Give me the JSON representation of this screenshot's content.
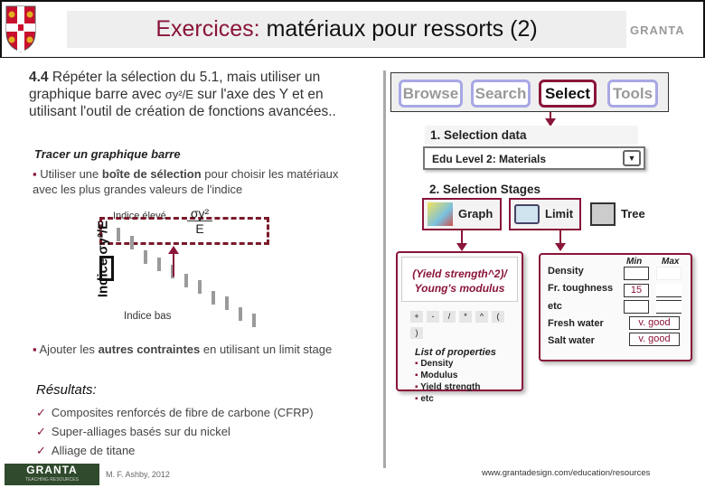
{
  "header": {
    "title_accent": "Exercices:",
    "title_rest": " matériaux pour ressorts (2)",
    "brand": "GRANTA"
  },
  "left": {
    "intro_num": "4.4",
    "intro_text": " Répéter la sélection du 5.1, mais utiliser un graphique barre avec ",
    "intro_formula": "σy²/E",
    "intro_text2": " sur l'axe des Y et en utilisant l'outil de création de fonctions avancées..",
    "subhead": "Tracer un graphique barre",
    "bullet1_pre": "Utiliser une ",
    "bullet1_bold": "boîte de sélection",
    "bullet1_post": " pour choisir les matériaux avec les plus grandes valeurs de l'indice",
    "diagram": {
      "high_label": "Indice élevé",
      "low_label": "Indice bas",
      "axis_label": "Indice σy²/E",
      "formula_num": "σy²",
      "formula_den": "E"
    },
    "bullet2_pre": "Ajouter les ",
    "bullet2_bold": "autres contraintes",
    "bullet2_post": " en utilisant un limit stage",
    "results_title": "Résultats:",
    "results": [
      "Composites renforcés de fibre de carbone (CFRP)",
      "Super-alliages basés sur du nickel",
      "Alliage de titane"
    ]
  },
  "right": {
    "toolbar": [
      "Browse",
      "Search",
      "Select",
      "Tools"
    ],
    "selection_data_title": "1. Selection data",
    "selection_data_value": "Edu Level 2: Materials",
    "stages_title": "2. Selection Stages",
    "stages": [
      "Graph",
      "Limit",
      "Tree"
    ],
    "graph_panel": {
      "function_line1": "(Yield strength^2)/",
      "function_line2": "Young's modulus",
      "operators": [
        "+",
        "-",
        "/",
        "*",
        "^",
        "(",
        ")"
      ],
      "list_title": "List of properties",
      "properties": [
        "Density",
        "Modulus",
        "Yield strength",
        "etc"
      ]
    },
    "limit_panel": {
      "min_label": "Min",
      "max_label": "Max",
      "rows": [
        {
          "label": "Density",
          "min": "",
          "max": ""
        },
        {
          "label": "Fr. toughness",
          "min": "15",
          "max": ""
        },
        {
          "label": "etc",
          "min": "",
          "max": ""
        }
      ],
      "fresh_label": "Fresh water",
      "fresh_value": "v. good",
      "salt_label": "Salt water",
      "salt_value": "v. good"
    }
  },
  "footer": {
    "logo": "GRANTA",
    "logo_sub": "TEACHING RESOURCES",
    "author": "M. F. Ashby, 2012",
    "url": "www.grantadesign.com/education/resources"
  },
  "colors": {
    "accent": "#8a1538",
    "toolbar_inactive": "#a8a8e6",
    "footer_logo_bg": "#2f4a2c"
  }
}
